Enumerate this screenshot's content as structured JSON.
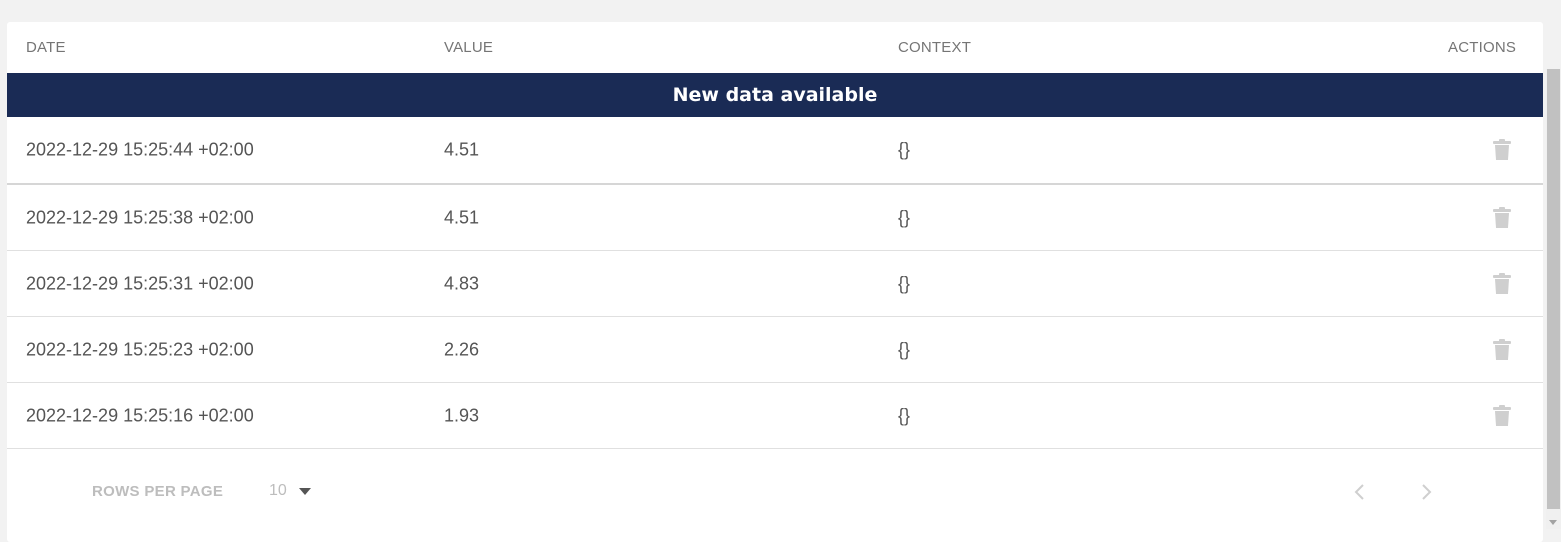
{
  "table": {
    "columns": {
      "date": "DATE",
      "value": "VALUE",
      "context": "CONTEXT",
      "actions": "ACTIONS"
    },
    "banner": "New data available",
    "rows": [
      {
        "date": "2022-12-29 15:25:44 +02:00",
        "value": "4.51",
        "context": "{}"
      },
      {
        "date": "2022-12-29 15:25:38 +02:00",
        "value": "4.51",
        "context": "{}"
      },
      {
        "date": "2022-12-29 15:25:31 +02:00",
        "value": "4.83",
        "context": "{}"
      },
      {
        "date": "2022-12-29 15:25:23 +02:00",
        "value": "2.26",
        "context": "{}"
      },
      {
        "date": "2022-12-29 15:25:16 +02:00",
        "value": "1.93",
        "context": "{}"
      }
    ],
    "row_action_icon": "trash-icon"
  },
  "pagination": {
    "rows_per_page_label": "ROWS PER PAGE",
    "rows_per_page_value": "10",
    "prev_icon": "chevron-left-icon",
    "next_icon": "chevron-right-icon"
  },
  "colors": {
    "banner_bg": "#1a2b55",
    "banner_text": "#ffffff",
    "icon_muted": "#cfcfcf"
  }
}
